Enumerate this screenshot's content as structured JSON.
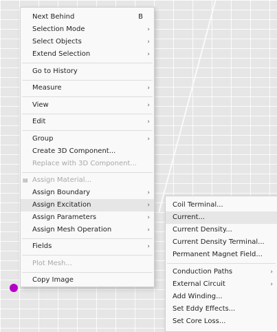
{
  "main_menu": {
    "next_behind": "Next Behind",
    "next_behind_shortcut": "B",
    "selection_mode": "Selection Mode",
    "select_objects": "Select Objects",
    "extend_selection": "Extend Selection",
    "go_to_history": "Go to History",
    "measure": "Measure",
    "view": "View",
    "edit": "Edit",
    "group": "Group",
    "create_3d_component": "Create 3D Component...",
    "replace_with_3d_component": "Replace with 3D Component...",
    "assign_material": "Assign Material...",
    "assign_boundary": "Assign Boundary",
    "assign_excitation": "Assign Excitation",
    "assign_parameters": "Assign Parameters",
    "assign_mesh_operation": "Assign Mesh Operation",
    "fields": "Fields",
    "plot_mesh": "Plot Mesh...",
    "copy_image": "Copy Image"
  },
  "submenu": {
    "coil_terminal": "Coil Terminal...",
    "current": "Current...",
    "current_density": "Current Density...",
    "current_density_terminal": "Current Density Terminal...",
    "permanent_magnet_field": "Permanent Magnet Field...",
    "conduction_paths": "Conduction Paths",
    "external_circuit": "External Circuit",
    "add_winding": "Add Winding...",
    "set_eddy_effects": "Set Eddy Effects...",
    "set_core_loss": "Set Core Loss..."
  },
  "glyphs": {
    "arrow": "›",
    "material_icon": "▤"
  },
  "colors": {
    "menu_bg": "#f9f9f9",
    "highlight_bg": "#e6e6e6",
    "disabled_text": "#a8a8a8",
    "marker": "#b400c8"
  }
}
